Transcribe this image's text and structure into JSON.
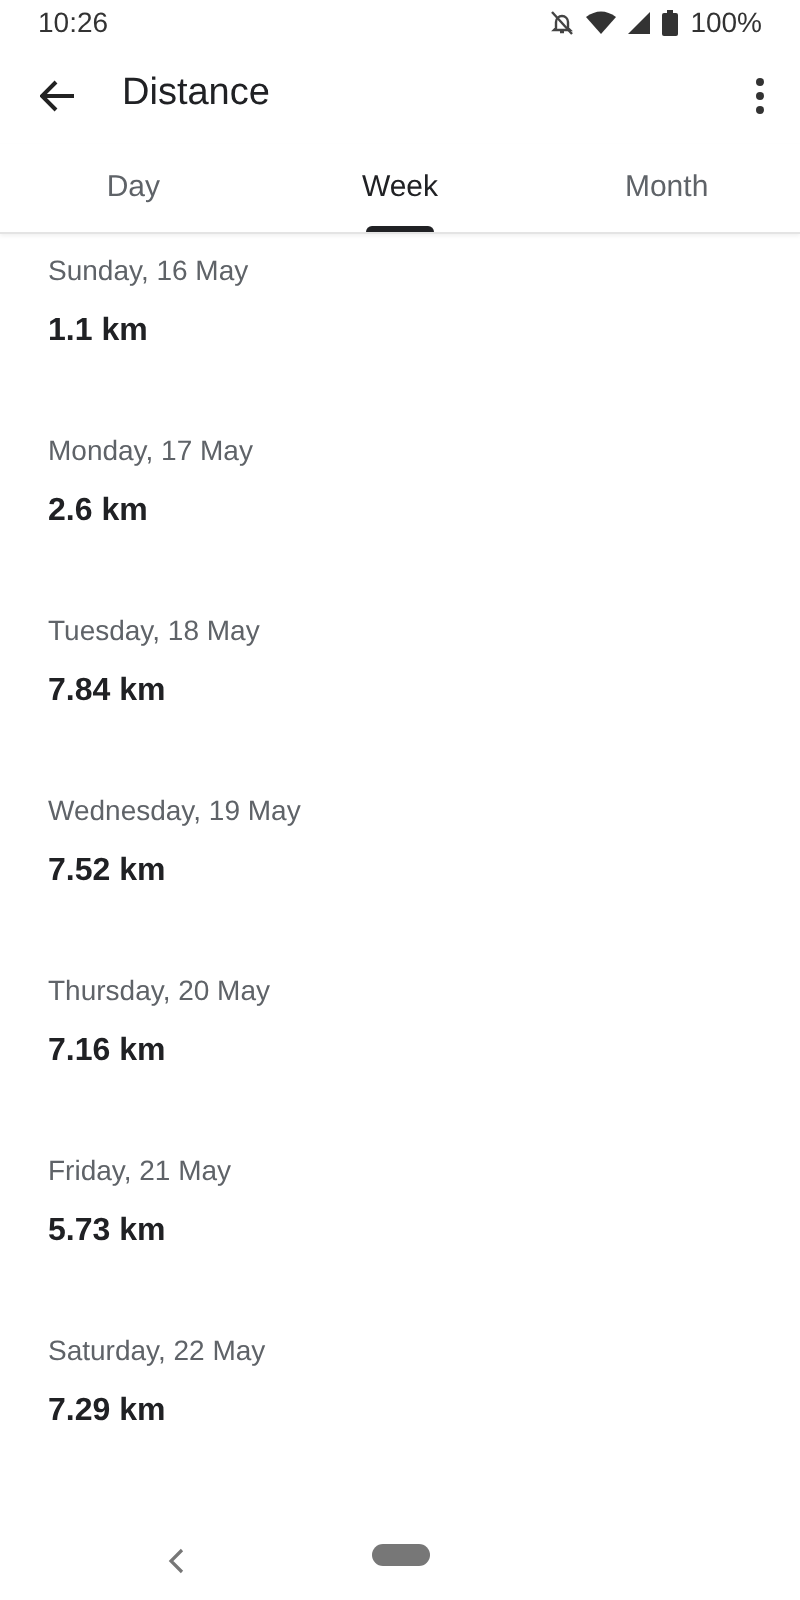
{
  "status_bar": {
    "time": "10:26",
    "battery": "100%"
  },
  "app_bar": {
    "title": "Distance"
  },
  "tabs": [
    {
      "label": "Day",
      "selected": false
    },
    {
      "label": "Week",
      "selected": true
    },
    {
      "label": "Month",
      "selected": false
    }
  ],
  "entries": [
    {
      "date": "Sunday, 16 May",
      "distance": "1.1 km"
    },
    {
      "date": "Monday, 17 May",
      "distance": "2.6 km"
    },
    {
      "date": "Tuesday, 18 May",
      "distance": "7.84 km"
    },
    {
      "date": "Wednesday, 19 May",
      "distance": "7.52 km"
    },
    {
      "date": "Thursday, 20 May",
      "distance": "7.16 km"
    },
    {
      "date": "Friday, 21 May",
      "distance": "5.73 km"
    },
    {
      "date": "Saturday, 22 May",
      "distance": "7.29 km"
    }
  ]
}
